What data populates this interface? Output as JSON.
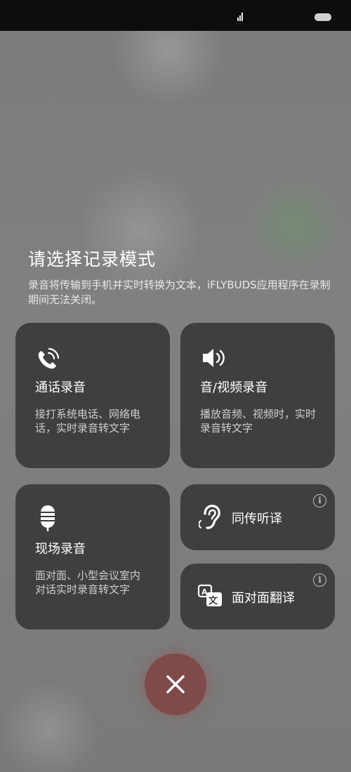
{
  "title": "请选择记录模式",
  "subtitle": "录音将传输到手机并实时转换为文本，iFLYBUDS应用程序在录制期间无法关闭。",
  "cards": {
    "call": {
      "name": "通话录音",
      "desc": "接打系统电话、网络电话，实时录音转文字",
      "icon": "phone-recording-icon"
    },
    "media": {
      "name": "音/视频录音",
      "desc": "播放音频、视频时，实时录音转文字",
      "icon": "speaker-icon"
    },
    "live": {
      "name": "现场录音",
      "desc": "面对面、小型会议室内对话实时录音转文字",
      "icon": "microphone-icon"
    },
    "simul": {
      "name": "同传听译",
      "icon": "ear-icon",
      "info": "i"
    },
    "f2f": {
      "name": "面对面翻译",
      "icon": "translate-icon",
      "info": "i"
    }
  },
  "close_icon": "close-icon",
  "colors": {
    "card_bg": "#3a3a3a",
    "close_bg": "#7f4a4a"
  }
}
